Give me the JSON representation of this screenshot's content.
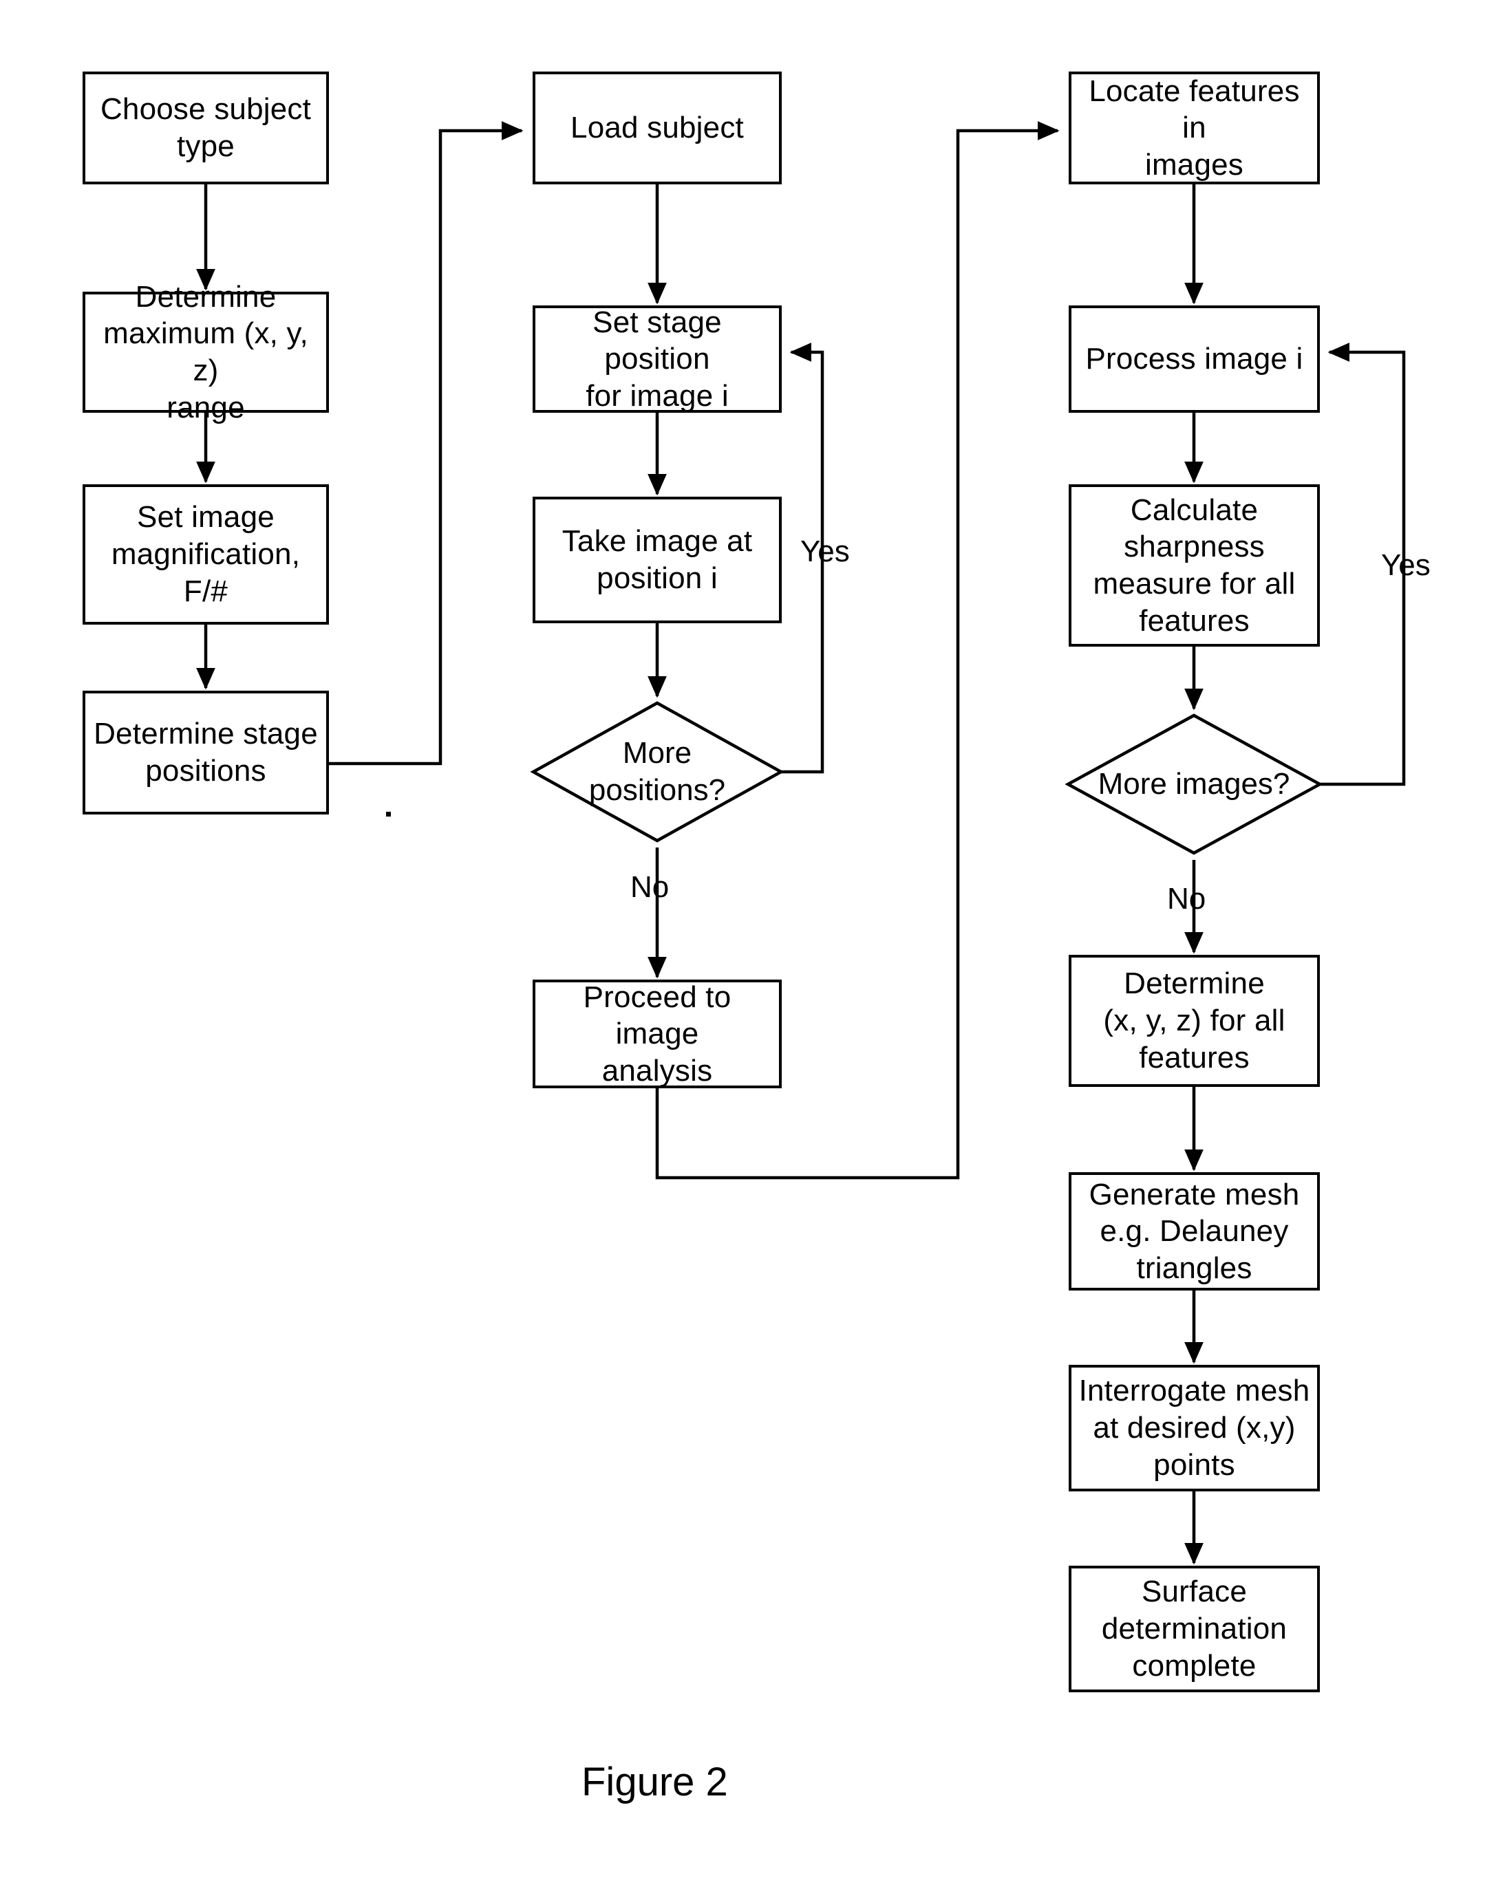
{
  "figure": {
    "caption": "Figure 2"
  },
  "colors": {
    "stroke": "#000000",
    "fill": "#ffffff",
    "text": "#000000"
  },
  "columns": {
    "left": {
      "name": "setup-column",
      "nodes": [
        {
          "id": "choose-subject-type",
          "shape": "process",
          "label": "Choose subject\ntype"
        },
        {
          "id": "determine-max-range",
          "shape": "process",
          "label": "Determine\nmaximum (x, y, z)\nrange"
        },
        {
          "id": "set-image-magnification",
          "shape": "process",
          "label": "Set image\nmagnification, F/#"
        },
        {
          "id": "determine-stage-positions",
          "shape": "process",
          "label": "Determine stage\npositions"
        }
      ]
    },
    "middle": {
      "name": "acquisition-column",
      "nodes": [
        {
          "id": "load-subject",
          "shape": "process",
          "label": "Load subject"
        },
        {
          "id": "set-stage-position",
          "shape": "process",
          "label": "Set stage position\nfor image i"
        },
        {
          "id": "take-image",
          "shape": "process",
          "label": "Take image at\nposition i"
        },
        {
          "id": "more-positions",
          "shape": "decision",
          "label": "More\npositions?"
        },
        {
          "id": "proceed-to-image-analysis",
          "shape": "process",
          "label": "Proceed to image\nanalysis"
        }
      ]
    },
    "right": {
      "name": "analysis-column",
      "nodes": [
        {
          "id": "locate-features",
          "shape": "process",
          "label": "Locate features in\nimages"
        },
        {
          "id": "process-image",
          "shape": "process",
          "label": "Process image i"
        },
        {
          "id": "calculate-sharpness",
          "shape": "process",
          "label": "Calculate\nsharpness\nmeasure for all\nfeatures"
        },
        {
          "id": "more-images",
          "shape": "decision",
          "label": "More images?"
        },
        {
          "id": "determine-xyz",
          "shape": "process",
          "label": "Determine\n(x, y, z) for all\nfeatures"
        },
        {
          "id": "generate-mesh",
          "shape": "process",
          "label": "Generate mesh\ne.g. Delauney\ntriangles"
        },
        {
          "id": "interrogate-mesh",
          "shape": "process",
          "label": "Interrogate mesh\nat desired (x,y)\npoints"
        },
        {
          "id": "surface-complete",
          "shape": "process",
          "label": "Surface\ndetermination\ncomplete"
        }
      ]
    }
  },
  "edge_labels": {
    "more_positions_yes": "Yes",
    "more_positions_no": "No",
    "more_images_yes": "Yes",
    "more_images_no": "No"
  },
  "chart_data": {
    "type": "diagram",
    "title": "Figure 2",
    "diagram_kind": "flowchart",
    "nodes": [
      {
        "id": "choose-subject-type",
        "label": "Choose subject type",
        "shape": "process",
        "column": "left"
      },
      {
        "id": "determine-max-range",
        "label": "Determine maximum (x, y, z) range",
        "shape": "process",
        "column": "left"
      },
      {
        "id": "set-image-magnification",
        "label": "Set image magnification, F/#",
        "shape": "process",
        "column": "left"
      },
      {
        "id": "determine-stage-positions",
        "label": "Determine stage positions",
        "shape": "process",
        "column": "left"
      },
      {
        "id": "load-subject",
        "label": "Load subject",
        "shape": "process",
        "column": "middle"
      },
      {
        "id": "set-stage-position",
        "label": "Set stage position for image i",
        "shape": "process",
        "column": "middle"
      },
      {
        "id": "take-image",
        "label": "Take image at position i",
        "shape": "process",
        "column": "middle"
      },
      {
        "id": "more-positions",
        "label": "More positions?",
        "shape": "decision",
        "column": "middle"
      },
      {
        "id": "proceed-to-image-analysis",
        "label": "Proceed to image analysis",
        "shape": "process",
        "column": "middle"
      },
      {
        "id": "locate-features",
        "label": "Locate features in images",
        "shape": "process",
        "column": "right"
      },
      {
        "id": "process-image",
        "label": "Process image i",
        "shape": "process",
        "column": "right"
      },
      {
        "id": "calculate-sharpness",
        "label": "Calculate sharpness measure for all features",
        "shape": "process",
        "column": "right"
      },
      {
        "id": "more-images",
        "label": "More images?",
        "shape": "decision",
        "column": "right"
      },
      {
        "id": "determine-xyz",
        "label": "Determine (x, y, z) for all features",
        "shape": "process",
        "column": "right"
      },
      {
        "id": "generate-mesh",
        "label": "Generate mesh e.g. Delauney triangles",
        "shape": "process",
        "column": "right"
      },
      {
        "id": "interrogate-mesh",
        "label": "Interrogate mesh at desired (x,y) points",
        "shape": "process",
        "column": "right"
      },
      {
        "id": "surface-complete",
        "label": "Surface determination complete",
        "shape": "process",
        "column": "right"
      }
    ],
    "edges": [
      {
        "from": "choose-subject-type",
        "to": "determine-max-range",
        "label": ""
      },
      {
        "from": "determine-max-range",
        "to": "set-image-magnification",
        "label": ""
      },
      {
        "from": "set-image-magnification",
        "to": "determine-stage-positions",
        "label": ""
      },
      {
        "from": "determine-stage-positions",
        "to": "load-subject",
        "label": ""
      },
      {
        "from": "load-subject",
        "to": "set-stage-position",
        "label": ""
      },
      {
        "from": "set-stage-position",
        "to": "take-image",
        "label": ""
      },
      {
        "from": "take-image",
        "to": "more-positions",
        "label": ""
      },
      {
        "from": "more-positions",
        "to": "set-stage-position",
        "label": "Yes"
      },
      {
        "from": "more-positions",
        "to": "proceed-to-image-analysis",
        "label": "No"
      },
      {
        "from": "proceed-to-image-analysis",
        "to": "locate-features",
        "label": ""
      },
      {
        "from": "locate-features",
        "to": "process-image",
        "label": ""
      },
      {
        "from": "process-image",
        "to": "calculate-sharpness",
        "label": ""
      },
      {
        "from": "calculate-sharpness",
        "to": "more-images",
        "label": ""
      },
      {
        "from": "more-images",
        "to": "process-image",
        "label": "Yes"
      },
      {
        "from": "more-images",
        "to": "determine-xyz",
        "label": "No"
      },
      {
        "from": "determine-xyz",
        "to": "generate-mesh",
        "label": ""
      },
      {
        "from": "generate-mesh",
        "to": "interrogate-mesh",
        "label": ""
      },
      {
        "from": "interrogate-mesh",
        "to": "surface-complete",
        "label": ""
      }
    ]
  }
}
